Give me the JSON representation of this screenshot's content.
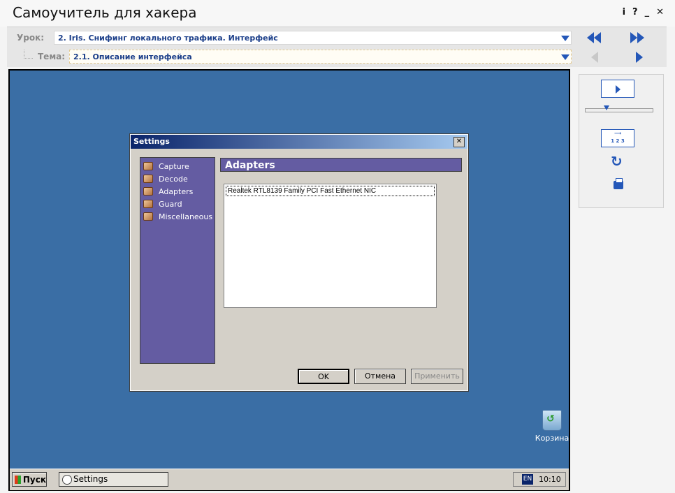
{
  "app": {
    "title": "Самоучитель для хакера",
    "controls": [
      "i",
      "?",
      "_",
      "✕"
    ]
  },
  "nav": {
    "lesson_label": "Урок:",
    "lesson_value": "2. Iris. Снифинг локального трафика. Интерфейс",
    "topic_label": "Тема:",
    "topic_value": "2.1. Описание интерфейса"
  },
  "dialog": {
    "title": "Settings",
    "sidebar_items": [
      "Capture",
      "Decode",
      "Adapters",
      "Guard",
      "Miscellaneous"
    ],
    "section_title": "Adapters",
    "adapters": [
      "Realtek RTL8139 Family PCI Fast Ethernet NIC"
    ],
    "buttons": {
      "ok": "OK",
      "cancel": "Отмена",
      "apply": "Применить"
    }
  },
  "desktop": {
    "recycle_bin_label": "Корзина"
  },
  "taskbar": {
    "start_label": "Пуск",
    "task_label": "Settings",
    "lang": "EN",
    "clock": "10:10"
  },
  "player": {
    "numbering_icon_text": "1 2 3"
  },
  "colors": {
    "desktop": "#3a6ea5",
    "dialog_sidebar": "#645ca2",
    "accent": "#2457b8"
  }
}
